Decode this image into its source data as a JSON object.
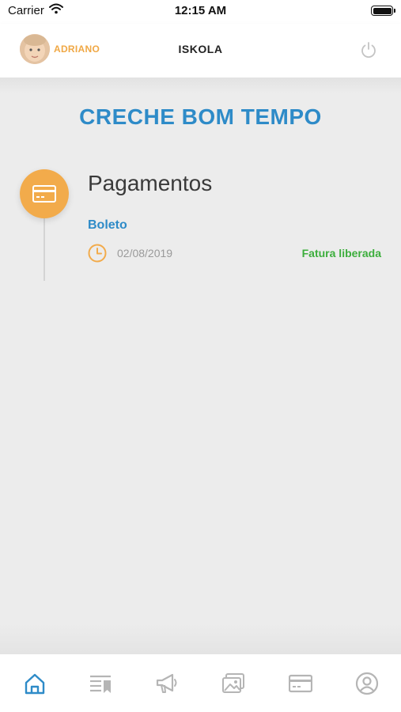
{
  "status_bar": {
    "carrier": "Carrier",
    "time": "12:15 AM"
  },
  "header": {
    "user_name": "ADRIANO",
    "app_title": "ISKOLA",
    "power_icon": "power-icon"
  },
  "main": {
    "school_name": "CRECHE BOM TEMPO",
    "section": {
      "title": "Pagamentos",
      "icon": "credit-card-icon",
      "items": [
        {
          "title": "Boleto",
          "date": "02/08/2019",
          "status": "Fatura liberada"
        }
      ]
    }
  },
  "tabbar": {
    "tabs": [
      {
        "icon": "home-icon",
        "active": true
      },
      {
        "icon": "list-bookmark-icon",
        "active": false
      },
      {
        "icon": "megaphone-icon",
        "active": false
      },
      {
        "icon": "photos-icon",
        "active": false
      },
      {
        "icon": "credit-card-icon",
        "active": false
      },
      {
        "icon": "profile-icon",
        "active": false
      }
    ]
  },
  "colors": {
    "accent_blue": "#2e8bc8",
    "accent_orange": "#f2ab4b",
    "status_green": "#3cae3c",
    "inactive_gray": "#b5b5b5"
  }
}
